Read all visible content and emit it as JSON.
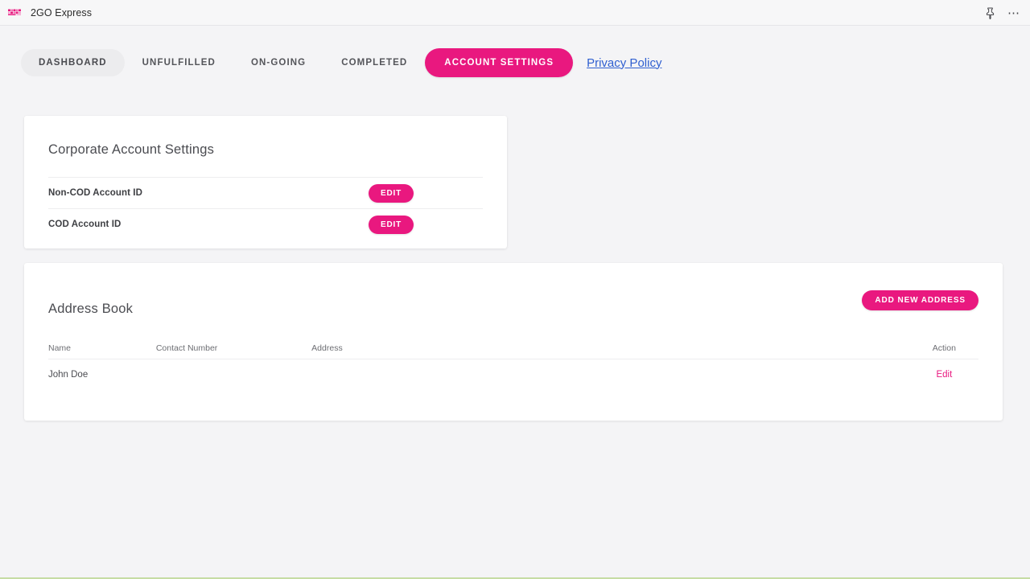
{
  "window": {
    "app_title": "2GO Express",
    "logo_icon": "2go-logo-icon",
    "pin_icon": "pin-icon",
    "more_icon": "more-options-icon",
    "accent_pink": "#e9187f",
    "page_background": "#f4f4f6",
    "bottom_accent_color": "#c5dca4"
  },
  "nav": {
    "tabs": [
      {
        "label": "DASHBOARD",
        "state": "selected-grey"
      },
      {
        "label": "UNFULFILLED",
        "state": "default"
      },
      {
        "label": "ON-GOING",
        "state": "default"
      },
      {
        "label": "COMPLETED",
        "state": "default"
      },
      {
        "label": "ACCOUNT SETTINGS",
        "state": "active-pink"
      }
    ],
    "privacy_link": "Privacy Policy"
  },
  "corporate_settings": {
    "title": "Corporate Account Settings",
    "rows": [
      {
        "label": "Non-COD Account ID",
        "button": "EDIT"
      },
      {
        "label": "COD Account ID",
        "button": "EDIT"
      }
    ]
  },
  "address_book": {
    "title": "Address Book",
    "add_button": "ADD NEW ADDRESS",
    "columns": [
      "Name",
      "Contact Number",
      "Address",
      "Action"
    ],
    "rows": [
      {
        "name": "John Doe",
        "contact": "",
        "address": "",
        "action": "Edit"
      }
    ]
  }
}
